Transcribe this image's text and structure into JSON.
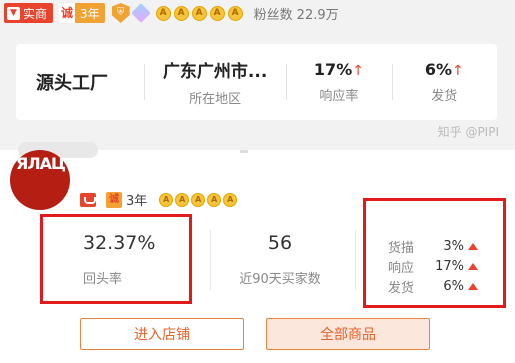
{
  "top": {
    "shop_type": "实商",
    "cheng_icon": "诚",
    "years": "3年",
    "shield_icon": "shield-badge-icon",
    "crowns": [
      "A",
      "A",
      "A",
      "A",
      "A"
    ],
    "fans_label": "粉丝数",
    "fans_value": "22.9万"
  },
  "card": {
    "name": "源头工厂",
    "region_value": "广东广州市...",
    "region_label": "所在地区",
    "response_value": "17%",
    "response_label": "响应率",
    "ship_value": "6%",
    "ship_label": "发货",
    "trend_symbol": "↑"
  },
  "watermark": "知乎 @PIPI",
  "bottom": {
    "avatar_text": "ЯЛАЦ",
    "cheng": "诚",
    "years": "3年",
    "crowns": [
      "A",
      "A",
      "A",
      "A",
      "A"
    ],
    "repurchase_value": "32.37%",
    "repurchase_label": "回头率",
    "buyers_value": "56",
    "buyers_label": "近90天买家数",
    "ratings": [
      {
        "label": "货描",
        "value": "3%"
      },
      {
        "label": "响应",
        "value": "17%"
      },
      {
        "label": "发货",
        "value": "6%"
      }
    ],
    "enter_button": "进入店铺",
    "all_button": "全部商品"
  },
  "colors": {
    "accent": "#e8432c",
    "highlight_border": "#e11b1b",
    "gold": "#f0a233"
  }
}
